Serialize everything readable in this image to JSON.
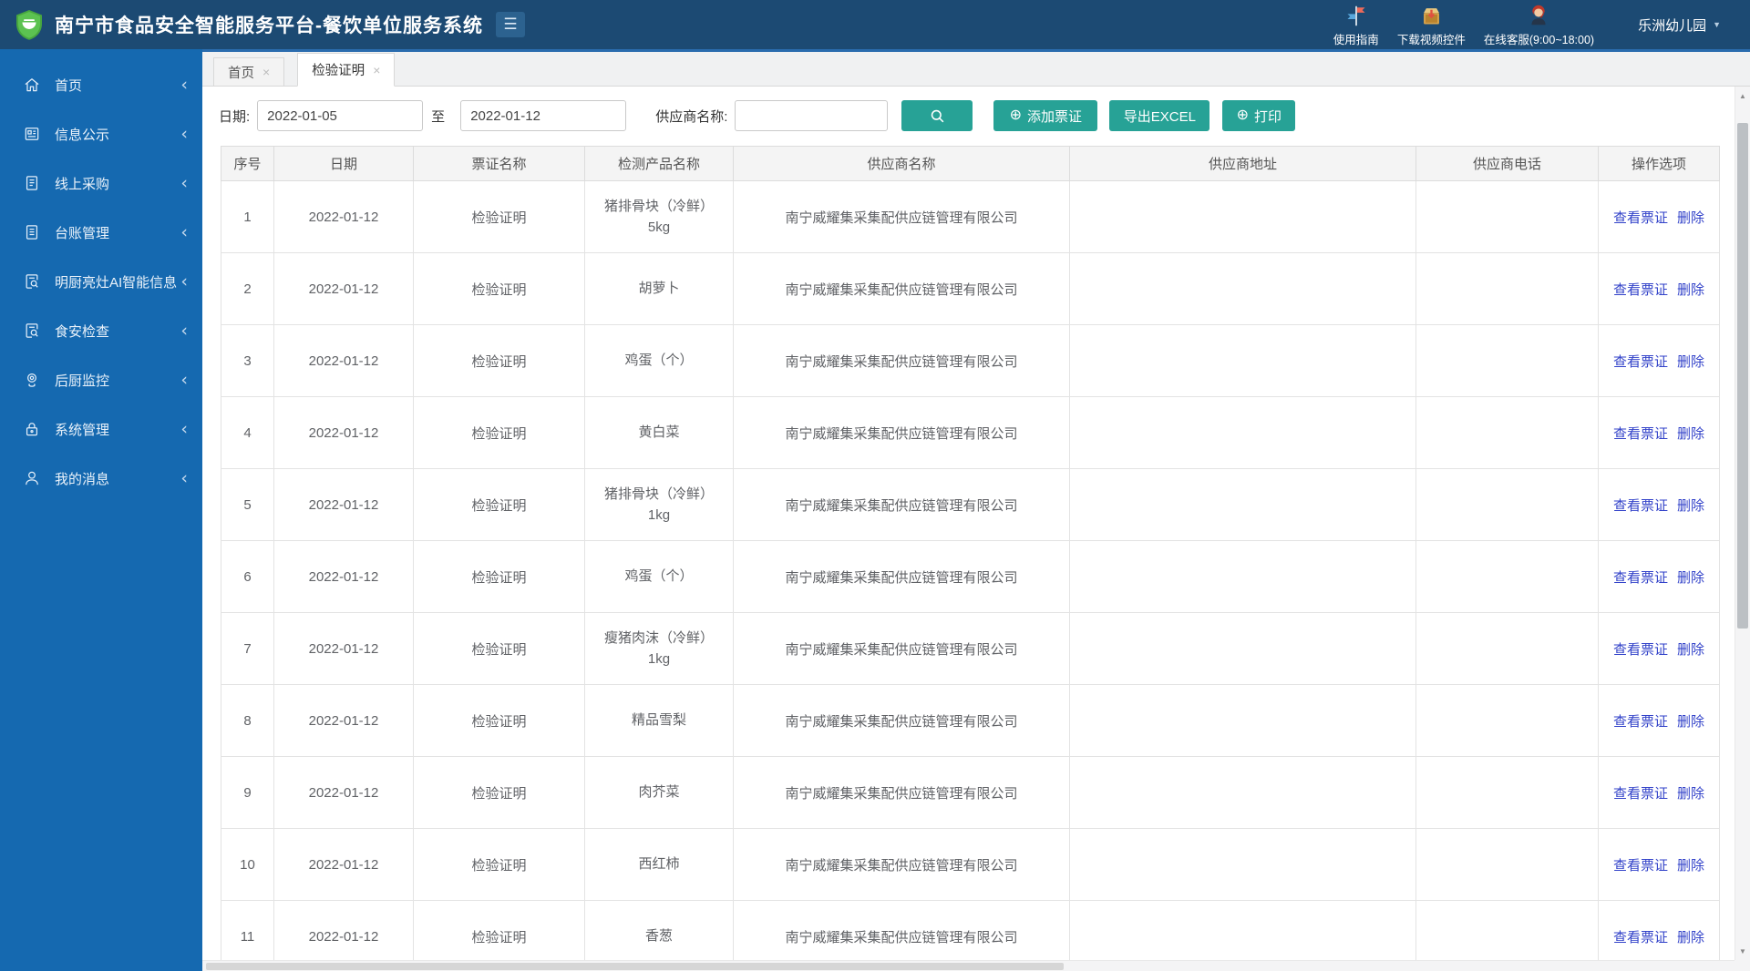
{
  "icons": {
    "close": "×",
    "caret_down": "▼",
    "hamburger": "☰",
    "plus": "⊕",
    "chevron_left": "‹",
    "scroll_up": "▲",
    "scroll_down": "▼"
  },
  "colors": {
    "header_bg": "#1c4a73",
    "sidebar_bg": "#1569b0",
    "accent_teal": "#27a296",
    "link_blue": "#3242c9"
  },
  "header": {
    "title": "南宁市食品安全智能服务平台-餐饮单位服务系统",
    "links": [
      {
        "label": "使用指南",
        "icon": "guide-signpost-icon"
      },
      {
        "label": "下载视频控件",
        "icon": "download-box-icon"
      },
      {
        "label": "在线客服(9:00~18:00)",
        "icon": "customer-service-icon"
      }
    ],
    "user": "乐洲幼儿园"
  },
  "sidebar": {
    "items": [
      {
        "label": "首页",
        "icon": "home-icon"
      },
      {
        "label": "信息公示",
        "icon": "bulletin-icon"
      },
      {
        "label": "线上采购",
        "icon": "purchase-doc-icon"
      },
      {
        "label": "台账管理",
        "icon": "ledger-doc-icon"
      },
      {
        "label": "明厨亮灶AI智能信息",
        "icon": "doc-search-icon"
      },
      {
        "label": "食安检查",
        "icon": "doc-search-icon"
      },
      {
        "label": "后厨监控",
        "icon": "camera-icon"
      },
      {
        "label": "系统管理",
        "icon": "lock-icon"
      },
      {
        "label": "我的消息",
        "icon": "person-icon"
      }
    ]
  },
  "tabs": [
    {
      "label": "首页"
    },
    {
      "label": "检验证明"
    }
  ],
  "filters": {
    "date_label": "日期:",
    "date_from": "2022-01-05",
    "to_label": "至",
    "date_to": "2022-01-12",
    "supplier_label": "供应商名称:",
    "supplier_value": "",
    "add_label": "添加票证",
    "export_label": "导出EXCEL",
    "print_label": "打印"
  },
  "table": {
    "columns": [
      "序号",
      "日期",
      "票证名称",
      "检测产品名称",
      "供应商名称",
      "供应商地址",
      "供应商电话",
      "操作选项"
    ],
    "actions": {
      "view": "查看票证",
      "delete": "删除"
    },
    "rows": [
      {
        "no": "1",
        "date": "2022-01-12",
        "cert": "检验证明",
        "product": "猪排骨块（冷鲜）\n5kg",
        "supplier": "南宁威耀集采集配供应链管理有限公司",
        "address": "",
        "phone": ""
      },
      {
        "no": "2",
        "date": "2022-01-12",
        "cert": "检验证明",
        "product": "胡萝卜",
        "supplier": "南宁威耀集采集配供应链管理有限公司",
        "address": "",
        "phone": ""
      },
      {
        "no": "3",
        "date": "2022-01-12",
        "cert": "检验证明",
        "product": "鸡蛋（个）",
        "supplier": "南宁威耀集采集配供应链管理有限公司",
        "address": "",
        "phone": ""
      },
      {
        "no": "4",
        "date": "2022-01-12",
        "cert": "检验证明",
        "product": "黄白菜",
        "supplier": "南宁威耀集采集配供应链管理有限公司",
        "address": "",
        "phone": ""
      },
      {
        "no": "5",
        "date": "2022-01-12",
        "cert": "检验证明",
        "product": "猪排骨块（冷鲜）\n1kg",
        "supplier": "南宁威耀集采集配供应链管理有限公司",
        "address": "",
        "phone": ""
      },
      {
        "no": "6",
        "date": "2022-01-12",
        "cert": "检验证明",
        "product": "鸡蛋（个）",
        "supplier": "南宁威耀集采集配供应链管理有限公司",
        "address": "",
        "phone": ""
      },
      {
        "no": "7",
        "date": "2022-01-12",
        "cert": "检验证明",
        "product": "瘦猪肉沫（冷鲜）\n1kg",
        "supplier": "南宁威耀集采集配供应链管理有限公司",
        "address": "",
        "phone": ""
      },
      {
        "no": "8",
        "date": "2022-01-12",
        "cert": "检验证明",
        "product": "精品雪梨",
        "supplier": "南宁威耀集采集配供应链管理有限公司",
        "address": "",
        "phone": ""
      },
      {
        "no": "9",
        "date": "2022-01-12",
        "cert": "检验证明",
        "product": "肉芥菜",
        "supplier": "南宁威耀集采集配供应链管理有限公司",
        "address": "",
        "phone": ""
      },
      {
        "no": "10",
        "date": "2022-01-12",
        "cert": "检验证明",
        "product": "西红柿",
        "supplier": "南宁威耀集采集配供应链管理有限公司",
        "address": "",
        "phone": ""
      },
      {
        "no": "11",
        "date": "2022-01-12",
        "cert": "检验证明",
        "product": "香葱",
        "supplier": "南宁威耀集采集配供应链管理有限公司",
        "address": "",
        "phone": ""
      }
    ]
  }
}
